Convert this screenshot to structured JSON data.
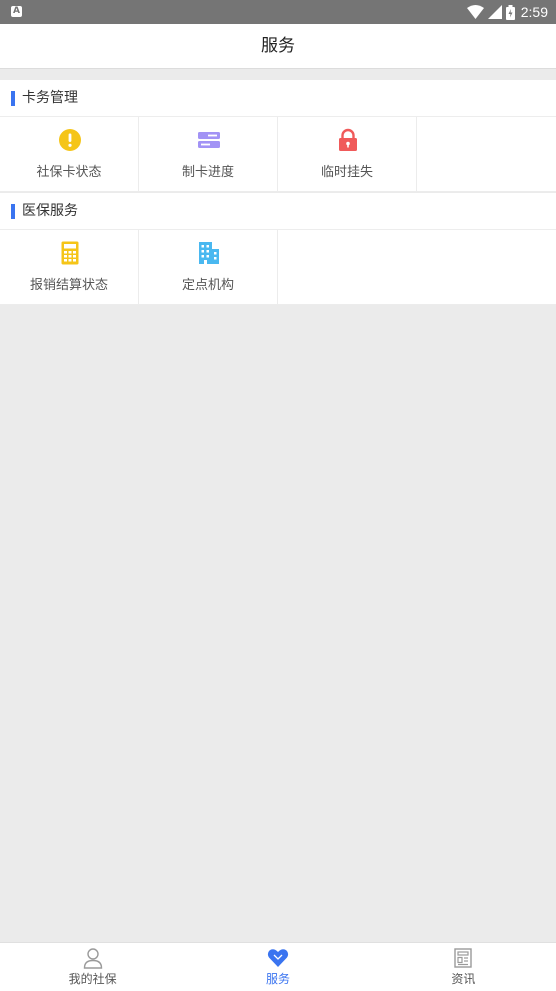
{
  "statusbar": {
    "time": "2:59",
    "notification_icon": "A"
  },
  "titlebar": {
    "title": "服务"
  },
  "sections": [
    {
      "title": "卡务管理",
      "items": [
        {
          "label": "社保卡状态",
          "icon": "alert-icon",
          "color": "#f5c518"
        },
        {
          "label": "制卡进度",
          "icon": "server-icon",
          "color": "#a293f5"
        },
        {
          "label": "临时挂失",
          "icon": "lock-icon",
          "color": "#f05a5a"
        }
      ]
    },
    {
      "title": "医保服务",
      "items": [
        {
          "label": "报销结算状态",
          "icon": "calculator-icon",
          "color": "#f5c518"
        },
        {
          "label": "定点机构",
          "icon": "building-icon",
          "color": "#4ab8f0"
        }
      ]
    }
  ],
  "tabbar": {
    "tabs": [
      {
        "label": "我的社保",
        "icon": "user-icon",
        "active": false
      },
      {
        "label": "服务",
        "icon": "heart-icon",
        "active": true
      },
      {
        "label": "资讯",
        "icon": "news-icon",
        "active": false
      }
    ],
    "active_color": "#3a74f0"
  }
}
